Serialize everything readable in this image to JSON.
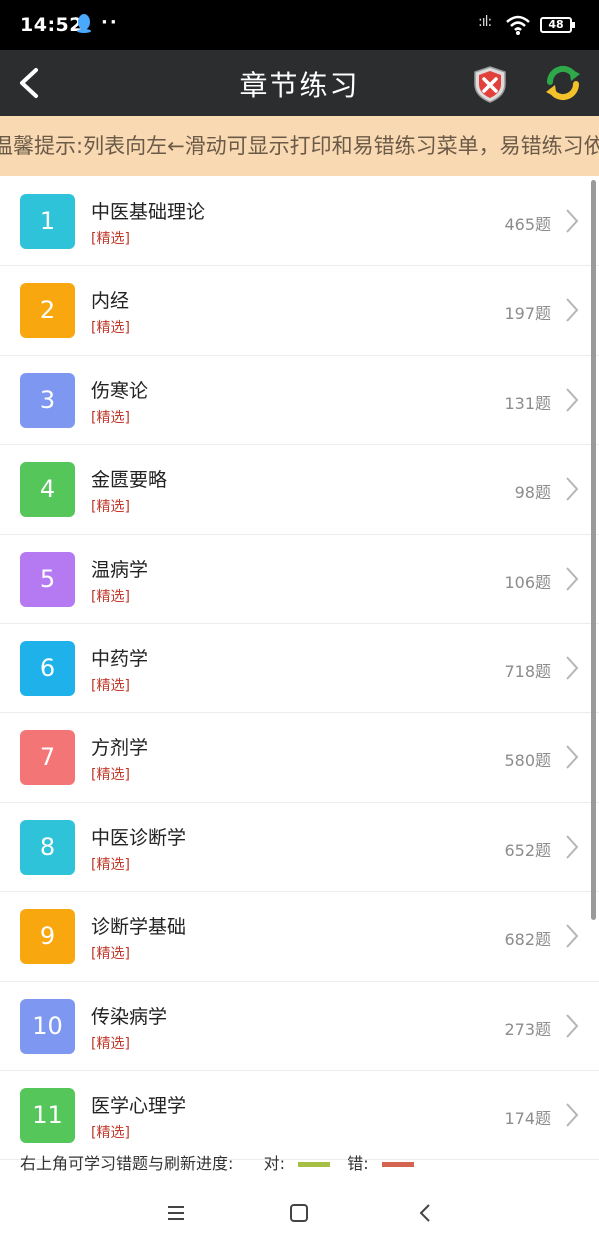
{
  "status_bar": {
    "time": "14:52",
    "dots": "··",
    "signal": ":ıl:",
    "battery": "48"
  },
  "header": {
    "title": "章节练习"
  },
  "tip": {
    "text": "温馨提示:列表向左←滑动可显示打印和易错练习菜单，易错练习依据"
  },
  "chapters": [
    {
      "index": "1",
      "name": "中医基础理论",
      "tag": "[精选]",
      "count": "465题",
      "color": "#2ec3d8"
    },
    {
      "index": "2",
      "name": "内经",
      "tag": "[精选]",
      "count": "197题",
      "color": "#f8a70e"
    },
    {
      "index": "3",
      "name": "伤寒论",
      "tag": "[精选]",
      "count": "131题",
      "color": "#7e98f2"
    },
    {
      "index": "4",
      "name": "金匮要略",
      "tag": "[精选]",
      "count": "98题",
      "color": "#55c65a"
    },
    {
      "index": "5",
      "name": "温病学",
      "tag": "[精选]",
      "count": "106题",
      "color": "#b57af2"
    },
    {
      "index": "6",
      "name": "中药学",
      "tag": "[精选]",
      "count": "718题",
      "color": "#1eb1ea"
    },
    {
      "index": "7",
      "name": "方剂学",
      "tag": "[精选]",
      "count": "580题",
      "color": "#f47575"
    },
    {
      "index": "8",
      "name": "中医诊断学",
      "tag": "[精选]",
      "count": "652题",
      "color": "#2ec3d8"
    },
    {
      "index": "9",
      "name": "诊断学基础",
      "tag": "[精选]",
      "count": "682题",
      "color": "#f8a70e"
    },
    {
      "index": "10",
      "name": "传染病学",
      "tag": "[精选]",
      "count": "273题",
      "color": "#7e98f2"
    },
    {
      "index": "11",
      "name": "医学心理学",
      "tag": "[精选]",
      "count": "174题",
      "color": "#55c65a"
    }
  ],
  "legend": {
    "text": "右上角可学习错题与刷新进度:",
    "correct_label": "对:",
    "correct_color": "#a6bf45",
    "wrong_label": "错:",
    "wrong_color": "#d3644f"
  },
  "icons": {
    "back": "back-arrow-icon",
    "wrong_questions": "wrong-questions-shield-icon",
    "refresh": "refresh-progress-icon",
    "chevron": "chevron-right-icon",
    "menu": "menu-icon",
    "home": "home-icon",
    "nav_back": "nav-back-icon"
  }
}
